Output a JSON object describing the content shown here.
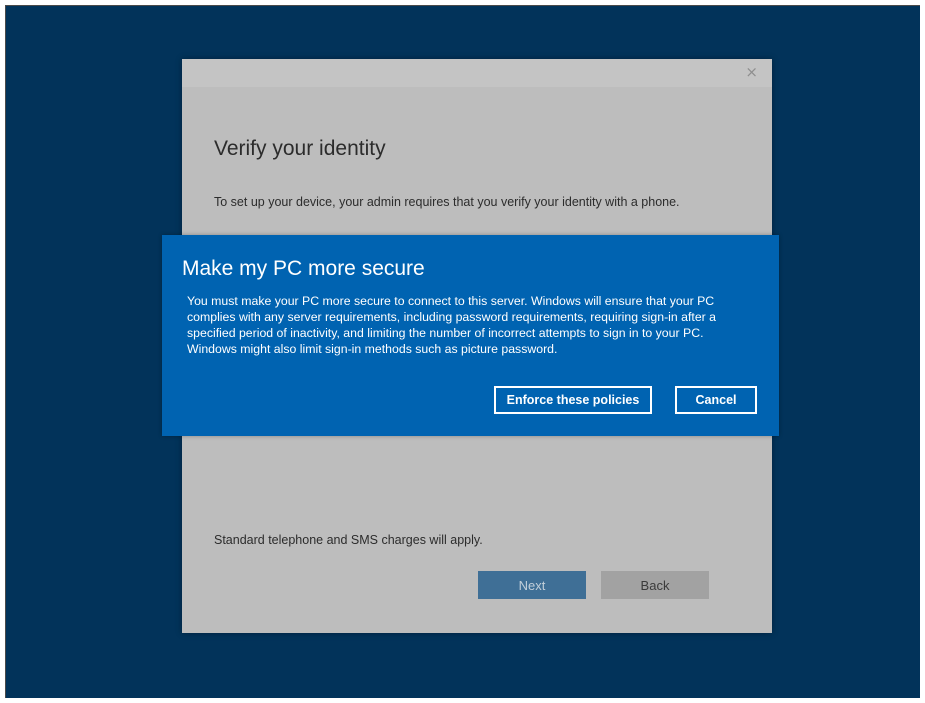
{
  "background_dialog": {
    "close_glyph": "×",
    "heading": "Verify your identity",
    "description": "To set up your device, your admin requires that you verify your identity with a phone.",
    "footer_note": "Standard telephone and SMS charges will apply.",
    "next_label": "Next",
    "back_label": "Back"
  },
  "prompt": {
    "title": "Make my PC more secure",
    "body": "You must make your PC more secure to connect to this server. Windows will ensure that your PC complies with any server requirements, including password requirements, requiring sign-in after a specified period of inactivity, and limiting the number of incorrect attempts to sign in to your PC. Windows might also limit sign-in methods such as picture password.",
    "enforce_label": "Enforce these policies",
    "cancel_label": "Cancel"
  },
  "colors": {
    "desktop_background": "#02335a",
    "prompt_background": "#0063b1",
    "dimmed_dialog": "#bdbdbd"
  },
  "icons": {
    "close": "close-icon"
  }
}
